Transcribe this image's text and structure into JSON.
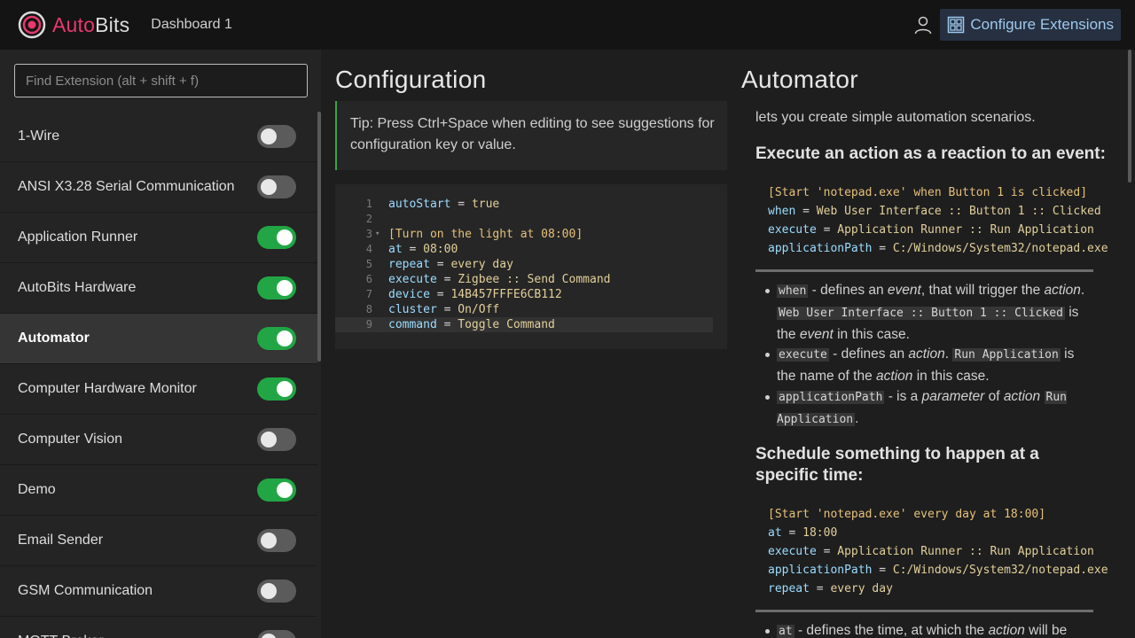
{
  "header": {
    "brand_part1": "Auto",
    "brand_part2": "Bits",
    "dashboard_title": "Dashboard 1",
    "configure_label": "Configure Extensions"
  },
  "sidebar": {
    "search_placeholder": "Find Extension (alt + shift + f)",
    "items": [
      {
        "label": "1-Wire",
        "enabled": false
      },
      {
        "label": "ANSI X3.28 Serial Communication",
        "enabled": false
      },
      {
        "label": "Application Runner",
        "enabled": true
      },
      {
        "label": "AutoBits Hardware",
        "enabled": true
      },
      {
        "label": "Automator",
        "enabled": true,
        "active": true
      },
      {
        "label": "Computer Hardware Monitor",
        "enabled": true
      },
      {
        "label": "Computer Vision",
        "enabled": false
      },
      {
        "label": "Demo",
        "enabled": true
      },
      {
        "label": "Email Sender",
        "enabled": false
      },
      {
        "label": "GSM Communication",
        "enabled": false
      },
      {
        "label": "MQTT Broker",
        "enabled": false
      }
    ]
  },
  "config": {
    "title": "Configuration",
    "tip": "Tip: Press Ctrl+Space when editing to see suggestions for configuration key or value.",
    "code_lines": [
      {
        "n": "1",
        "key": "autoStart",
        "op": " = ",
        "val": "true"
      },
      {
        "n": "2",
        "key": "",
        "op": "",
        "val": ""
      },
      {
        "n": "3",
        "section": "[Turn on the light at 08:00]",
        "fold": true
      },
      {
        "n": "4",
        "key": "at",
        "op": " = ",
        "val": "08:00"
      },
      {
        "n": "5",
        "key": "repeat",
        "op": " = ",
        "val": "every day"
      },
      {
        "n": "6",
        "key": "execute",
        "op": " = ",
        "val": "Zigbee :: Send Command"
      },
      {
        "n": "7",
        "key": "device",
        "op": " = ",
        "val": "14B457FFFE6CB112"
      },
      {
        "n": "8",
        "key": "cluster",
        "op": " = ",
        "val": "On/Off"
      },
      {
        "n": "9",
        "key": "command",
        "op": " = ",
        "val": "Toggle Command",
        "highlight": true
      }
    ]
  },
  "automator": {
    "title": "Automator",
    "intro": "lets you create simple automation scenarios.",
    "heading1": "Execute an action as a reaction to an event:",
    "example1": {
      "section": "[Start 'notepad.exe' when Button 1 is clicked]",
      "lines": [
        {
          "key": "when",
          "val": "Web User Interface :: Button 1 :: Clicked"
        },
        {
          "key": "execute",
          "val": "Application Runner :: Run Application"
        },
        {
          "key": "applicationPath",
          "val": "C:/Windows/System32/notepad.exe"
        }
      ]
    },
    "bullets1": {
      "b1_code": "when",
      "b1_t1": " - defines an ",
      "b1_em1": "event",
      "b1_t2": ", that will trigger the ",
      "b1_em2": "action",
      "b1_t3": ". ",
      "b1_code2": "Web User Interface :: Button 1 :: Clicked",
      "b1_t4": " is the ",
      "b1_em3": "event",
      "b1_t5": " in this case.",
      "b2_code": "execute",
      "b2_t1": " - defines an ",
      "b2_em1": "action",
      "b2_t2": ". ",
      "b2_code2": "Run Application",
      "b2_t3": " is the name of the ",
      "b2_em2": "action",
      "b2_t4": " in this case.",
      "b3_code": "applicationPath",
      "b3_t1": " - is a ",
      "b3_em1": "parameter",
      "b3_t2": " of ",
      "b3_em2": "action",
      "b3_t3": " ",
      "b3_code2": "Run Application",
      "b3_t4": "."
    },
    "heading2": "Schedule something to happen at a specific time:",
    "example2": {
      "section": "[Start 'notepad.exe' every day at 18:00]",
      "lines": [
        {
          "key": "at",
          "val": "18:00"
        },
        {
          "key": "execute",
          "val": "Application Runner :: Run Application"
        },
        {
          "key": "applicationPath",
          "val": "C:/Windows/System32/notepad.exe"
        },
        {
          "key": "repeat",
          "val": "every day"
        }
      ]
    },
    "bullets2": {
      "b1_code": "at",
      "b1_t1": " - defines the time, at which the ",
      "b1_em1": "action",
      "b1_t2": " will be"
    }
  },
  "colors": {
    "accent_pink": "#e8386e",
    "toggle_on": "#22a645",
    "toggle_off": "#5b5b5b",
    "tip_border": "#3fa24b",
    "code_key": "#9cdcfe",
    "code_value": "#e2cf9a"
  }
}
